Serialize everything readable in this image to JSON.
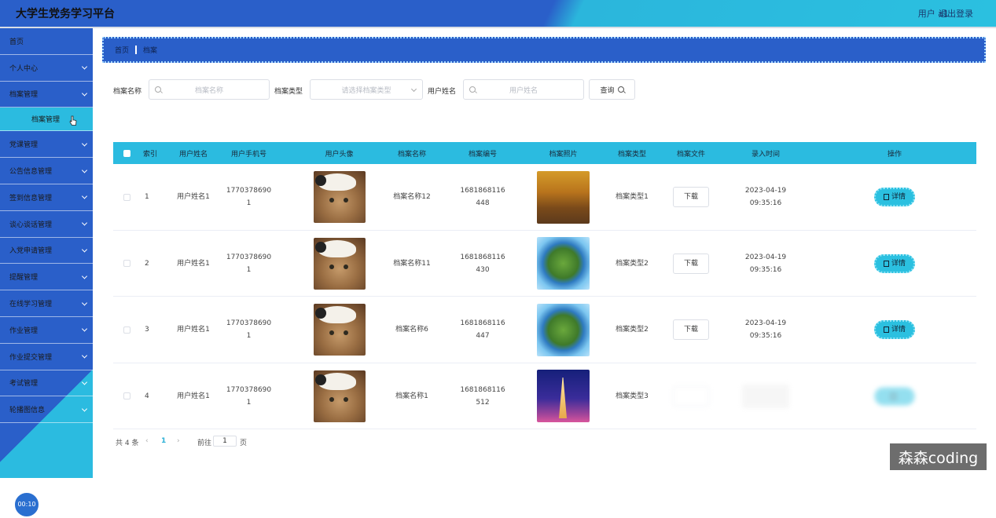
{
  "header": {
    "title": "大学生党务学习平台",
    "user": "用户 a1",
    "logout": "退出登录"
  },
  "sidebar": {
    "items": [
      {
        "label": "首页",
        "has_arrow": false
      },
      {
        "label": "个人中心",
        "has_arrow": true
      },
      {
        "label": "档案管理",
        "has_arrow": true
      },
      {
        "label": "党课管理",
        "has_arrow": true
      },
      {
        "label": "公告信息管理",
        "has_arrow": true
      },
      {
        "label": "签到信息管理",
        "has_arrow": true
      },
      {
        "label": "谈心谈话管理",
        "has_arrow": true
      },
      {
        "label": "入党申请管理",
        "has_arrow": true
      },
      {
        "label": "提醒管理",
        "has_arrow": true
      },
      {
        "label": "在线学习管理",
        "has_arrow": true
      },
      {
        "label": "作业管理",
        "has_arrow": true
      },
      {
        "label": "作业提交管理",
        "has_arrow": true
      },
      {
        "label": "考试管理",
        "has_arrow": true
      },
      {
        "label": "轮播图信息",
        "has_arrow": true
      }
    ],
    "submenu": "档案管理",
    "timer": "00:10"
  },
  "breadcrumb": {
    "home": "首页",
    "current": "档案"
  },
  "search": {
    "name_label": "档案名称",
    "name_placeholder": "档案名称",
    "type_label": "档案类型",
    "type_placeholder": "请选择档案类型",
    "user_label": "用户姓名",
    "user_placeholder": "用户姓名",
    "query_label": "查询"
  },
  "table": {
    "headers": [
      "索引",
      "用户姓名",
      "用户手机号",
      "用户头像",
      "档案名称",
      "档案编号",
      "档案照片",
      "档案类型",
      "档案文件",
      "录入时间",
      "操作"
    ],
    "rows": [
      {
        "index": "1",
        "user": "用户姓名1",
        "phone1": "1770378690",
        "phone2": "1",
        "name": "档案名称12",
        "code1": "1681868116",
        "code2": "448",
        "photo": "autumn",
        "type": "档案类型1",
        "download": "下载",
        "time1": "2023-04-19",
        "time2": "09:35:16",
        "action": "详情"
      },
      {
        "index": "2",
        "user": "用户姓名1",
        "phone1": "1770378690",
        "phone2": "1",
        "name": "档案名称11",
        "code1": "1681868116",
        "code2": "430",
        "photo": "planet",
        "type": "档案类型2",
        "download": "下载",
        "time1": "2023-04-19",
        "time2": "09:35:16",
        "action": "详情"
      },
      {
        "index": "3",
        "user": "用户姓名1",
        "phone1": "1770378690",
        "phone2": "1",
        "name": "档案名称6",
        "code1": "1681868116",
        "code2": "447",
        "photo": "planet",
        "type": "档案类型2",
        "download": "下载",
        "time1": "2023-04-19",
        "time2": "09:35:16",
        "action": "详情"
      },
      {
        "index": "4",
        "user": "用户姓名1",
        "phone1": "1770378690",
        "phone2": "1",
        "name": "档案名称1",
        "code1": "1681868116",
        "code2": "512",
        "photo": "eiffel",
        "type": "档案类型3",
        "download": "",
        "time1": "",
        "time2": "",
        "action": ""
      }
    ]
  },
  "pagination": {
    "total": "共 4 条",
    "prev": "‹",
    "page": "1",
    "next": "›",
    "goto": "前往",
    "goto_value": "1",
    "unit": "页"
  },
  "watermark": "森森coding"
}
